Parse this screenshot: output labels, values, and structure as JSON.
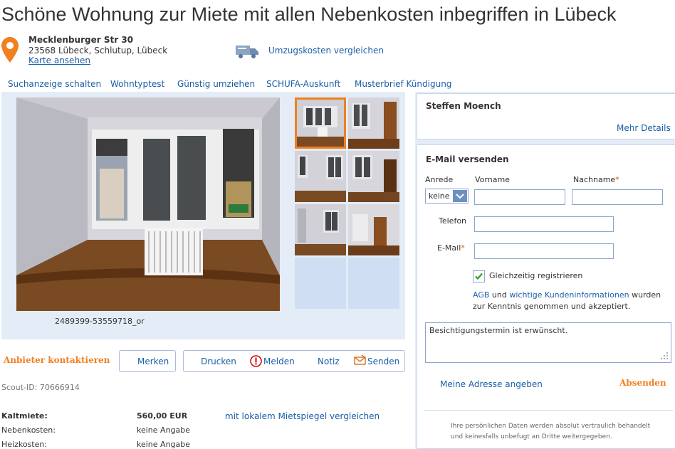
{
  "title": "Schöne Wohnung zur Miete mit allen Nebenkosten inbegriffen in Lübeck",
  "address": {
    "street": "Mecklenburger Str 30",
    "city": "23568 Lübeck, Schlutup, Lübeck",
    "map_link": "Karte ansehen"
  },
  "moving_costs_link": "Umzugskosten vergleichen",
  "nav": [
    "Suchanzeige schalten",
    "Wohntyptest",
    "Günstig umziehen",
    "SCHUFA-Auskunft",
    "Musterbrief Kündigung"
  ],
  "gallery": {
    "caption": "2489399-53559718_or",
    "selected_thumb": 1,
    "thumb_count": 6
  },
  "actions": {
    "contact": "Anbieter kontaktieren",
    "merken": "Merken",
    "drucken": "Drucken",
    "melden": "Melden",
    "notiz": "Notiz",
    "senden": "Senden"
  },
  "scout_id": "Scout-ID: 70666914",
  "facts": [
    {
      "label": "Kaltmiete:",
      "value": "560,00 EUR",
      "bold": true
    },
    {
      "label": "Nebenkosten:",
      "value": "keine Angabe",
      "bold": false
    },
    {
      "label": "Heizkosten:",
      "value": "keine Angabe",
      "bold": false
    }
  ],
  "mietspiegel_link": "mit lokalem Mietspiegel vergleichen",
  "landlord": {
    "name": "Steffen Moench",
    "more_details": "Mehr Details"
  },
  "form": {
    "heading": "E-Mail versenden",
    "anrede_label": "Anrede",
    "anrede_value": "keine",
    "vorname_label": "Vorname",
    "nachname_label": "Nachname",
    "required_mark": "*",
    "telefon_label": "Telefon",
    "email_label": "E-Mail",
    "register_label": "Gleichzeitig registrieren",
    "register_checked": true,
    "terms_agb": "AGB",
    "terms_and": "und",
    "terms_link": "wichtige Kundeninformationen",
    "terms_rest1": "wurden",
    "terms_rest2": "zur Kenntnis genommen und akzeptiert.",
    "message": "Besichtigungstermin ist erwünscht.",
    "address_link": "Meine Adresse angeben",
    "submit": "Absenden",
    "privacy1": "Ihre persönlichen Daten werden absolut vertraulich behandelt",
    "privacy2": "und keinesfalls unbefugt an Dritte weitergegeben."
  },
  "colors": {
    "accent_orange": "#f08020",
    "link_blue": "#1a5ea8",
    "panel_blue": "#e4ecf7"
  }
}
